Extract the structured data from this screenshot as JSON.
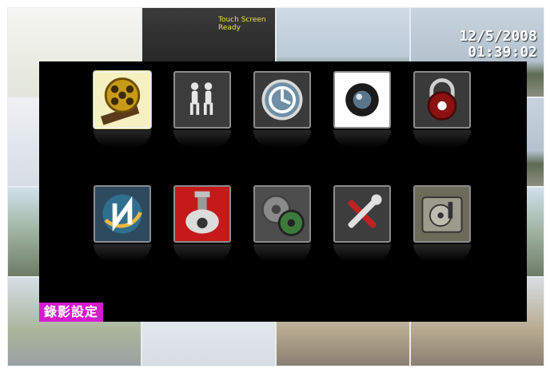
{
  "camera_grid": {
    "tiles": [
      "t0",
      "t1",
      "t2",
      "t3",
      "t4",
      "t0",
      "t3",
      "t3",
      "t5",
      "t4",
      "t3",
      "t5",
      "t6",
      "t4",
      "t7",
      "t7"
    ],
    "osd_date": "12/5/2008",
    "osd_time": "01:39:02",
    "touch_text": "Touch Screen Ready"
  },
  "menu": {
    "caption": "錄影設定",
    "items": [
      {
        "name": "record-icon",
        "selected": true
      },
      {
        "name": "people-icon",
        "selected": false
      },
      {
        "name": "playback-icon",
        "selected": false
      },
      {
        "name": "camera-icon",
        "selected": false
      },
      {
        "name": "lock-icon",
        "selected": false
      },
      {
        "name": "network-icon",
        "selected": false
      },
      {
        "name": "ptz-camera-icon",
        "selected": false
      },
      {
        "name": "gears-icon",
        "selected": false
      },
      {
        "name": "tools-icon",
        "selected": false
      },
      {
        "name": "disk-icon",
        "selected": false
      }
    ]
  }
}
